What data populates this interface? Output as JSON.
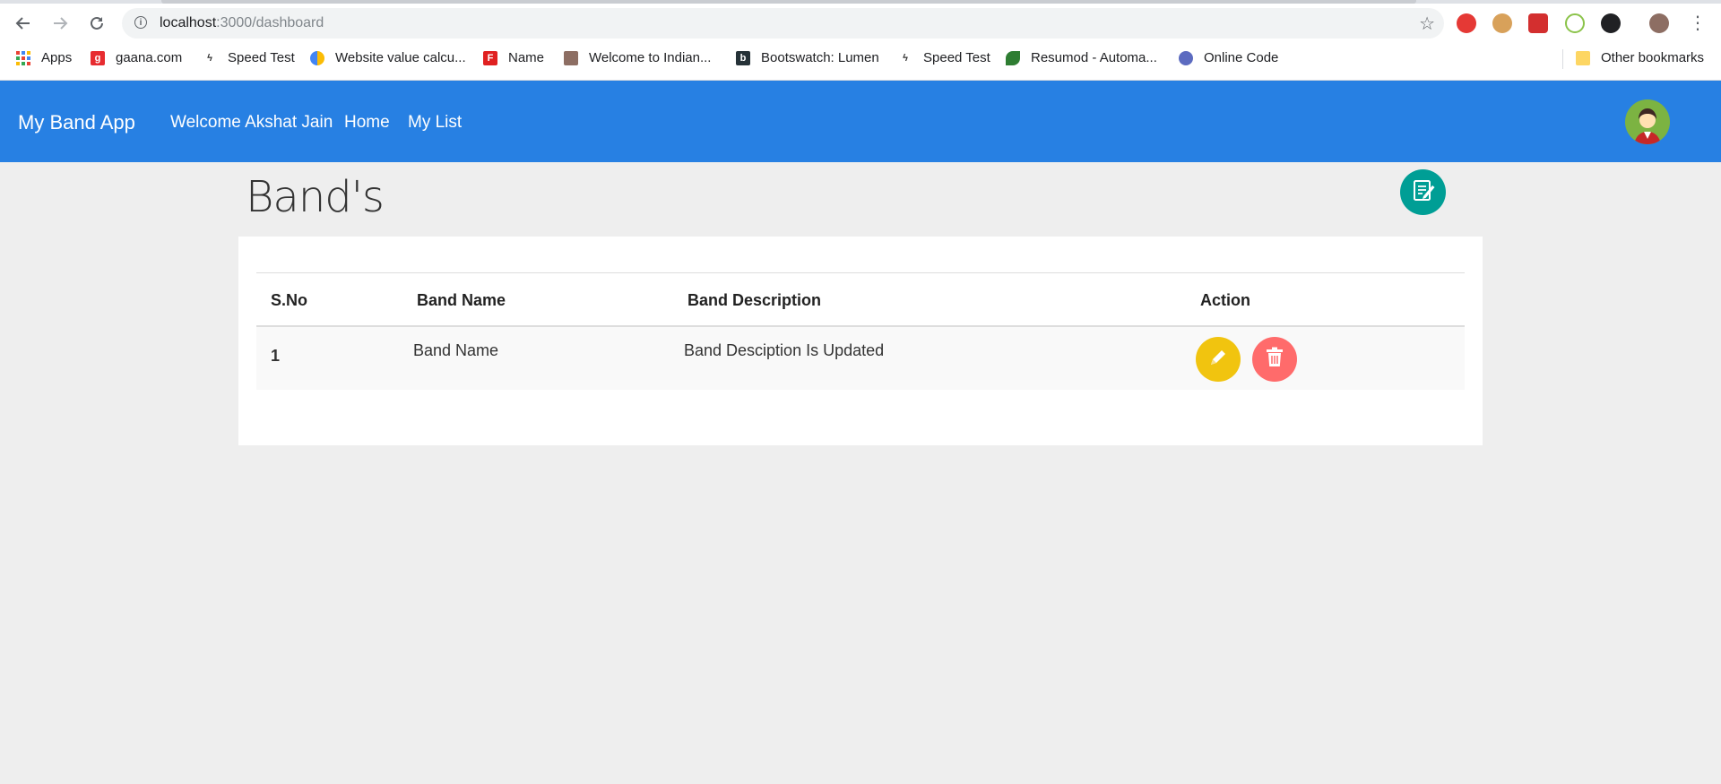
{
  "browser": {
    "url_host": "localhost",
    "url_path": ":3000/dashboard",
    "bookmarks": [
      {
        "label": "Apps",
        "icon": "apps-grid-icon"
      },
      {
        "label": "gaana.com",
        "icon": "gaana-icon"
      },
      {
        "label": "Speed Test",
        "icon": "speedtest-icon"
      },
      {
        "label": "Website value calcu...",
        "icon": "globe-pie-icon"
      },
      {
        "label": "Name",
        "icon": "f-logo-icon"
      },
      {
        "label": "Welcome to Indian...",
        "icon": "indian-site-icon"
      },
      {
        "label": "Bootswatch: Lumen",
        "icon": "bootswatch-icon"
      },
      {
        "label": "Speed Test",
        "icon": "speedtest-icon"
      },
      {
        "label": "Resumod - Automa...",
        "icon": "resumod-icon"
      },
      {
        "label": "Online Code",
        "icon": "online-code-icon"
      }
    ],
    "other_bookmarks": "Other bookmarks"
  },
  "navbar": {
    "brand": "My Band App",
    "welcome": "Welcome Akshat Jain",
    "home": "Home",
    "mylist": "My List",
    "color": "#2780e3"
  },
  "page": {
    "title": "Band's"
  },
  "table": {
    "headers": [
      "S.No",
      "Band Name",
      "Band Description",
      "Action"
    ],
    "rows": [
      {
        "sno": "1",
        "name": "Band Name",
        "description": "Band Desciption Is Updated"
      }
    ]
  },
  "colors": {
    "add_button": "#009e95",
    "edit_button": "#f1c40f",
    "delete_button": "#ff6b6b"
  }
}
